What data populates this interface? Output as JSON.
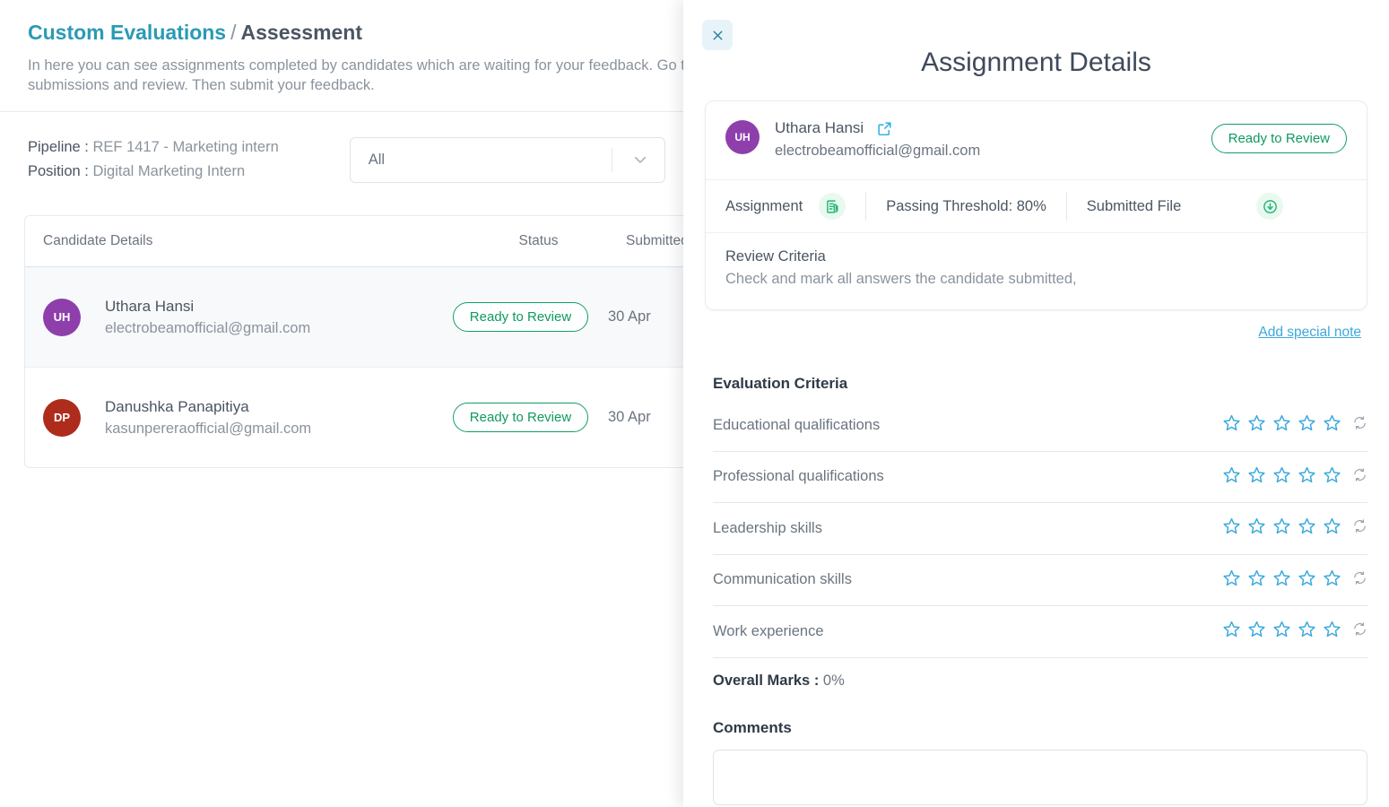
{
  "header": {
    "breadcrumb_root": "Custom Evaluations",
    "breadcrumb_separator": "/",
    "breadcrumb_current": "Assessment",
    "description": "In here you can see assignments completed by candidates which are waiting for your feedback. Go through the submissions and review. Then submit your feedback."
  },
  "filters": {
    "pipeline_label": "Pipeline :",
    "pipeline_value": "REF 1417 - Marketing intern",
    "position_label": "Position :",
    "position_value": "Digital Marketing Intern",
    "select_value": "All"
  },
  "table": {
    "columns": {
      "candidate": "Candidate Details",
      "status": "Status",
      "submitted": "Submitted"
    },
    "rows": [
      {
        "initials": "UH",
        "avatar_color": "#8e3fac",
        "name": "Uthara Hansi",
        "email": "electrobeamofficial@gmail.com",
        "status": "Ready to Review",
        "submitted": "30 Apr"
      },
      {
        "initials": "DP",
        "avatar_color": "#ae2c1c",
        "name": "Danushka Panapitiya",
        "email": "kasunpereraofficial@gmail.com",
        "status": "Ready to Review",
        "submitted": "30 Apr"
      }
    ]
  },
  "panel": {
    "title": "Assignment Details",
    "close_label": "×",
    "candidate": {
      "initials": "UH",
      "avatar_color": "#8e3fac",
      "name": "Uthara Hansi",
      "email": "electrobeamofficial@gmail.com",
      "status": "Ready to Review"
    },
    "assignment_label": "Assignment",
    "passing_threshold": "Passing Threshold: 80%",
    "submitted_file_label": "Submitted File",
    "review_criteria_title": "Review Criteria",
    "review_criteria_body": "Check and mark all answers the candidate submitted,",
    "add_special_note": "Add special note",
    "evaluation_heading": "Evaluation Criteria",
    "criteria": [
      {
        "label": "Educational qualifications",
        "rating": 0,
        "max": 5
      },
      {
        "label": "Professional qualifications",
        "rating": 0,
        "max": 5
      },
      {
        "label": "Leadership skills",
        "rating": 0,
        "max": 5
      },
      {
        "label": "Communication skills",
        "rating": 0,
        "max": 5
      },
      {
        "label": "Work experience",
        "rating": 0,
        "max": 5
      }
    ],
    "overall_marks_label": "Overall Marks :",
    "overall_marks_value": "0%",
    "comments_heading": "Comments",
    "comments_value": "",
    "comments_placeholder": ""
  },
  "colors": {
    "brand_teal": "#2a9ab5",
    "link_blue": "#3ba9dc",
    "star_blue": "#3ba9dc",
    "status_green": "#0f9a5f",
    "icon_green": "#22b573"
  }
}
